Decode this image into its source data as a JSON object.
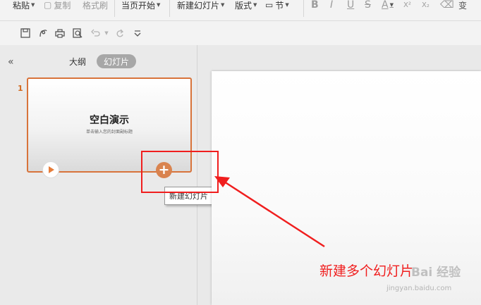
{
  "ribbon": {
    "paste": "粘贴",
    "copy": "复制",
    "format_painter": "格式刷",
    "play_from_current": "当页开始",
    "new_slide": "新建幻灯片",
    "layout": "版式",
    "section": "节",
    "bold": "B",
    "italic": "I",
    "underline": "U",
    "strike": "S",
    "font_color": "A",
    "superscript": "X²",
    "subscript": "X₂",
    "more": "变"
  },
  "panel": {
    "collapse_icon": "«",
    "tab_outline": "大纲",
    "tab_slides": "幻灯片",
    "slide_number": "1",
    "slide_title": "空白演示",
    "slide_subtitle": "单击输入您的封面副标题",
    "tooltip": "新建幻灯片"
  },
  "annotation": {
    "callout": "新建多个幻灯片",
    "color": "#f01e1e"
  },
  "watermark": {
    "logo": "Bai 经验",
    "url": "jingyan.baidu.com"
  },
  "colors": {
    "accent": "#d8733a",
    "plus_button": "#d9834f"
  }
}
